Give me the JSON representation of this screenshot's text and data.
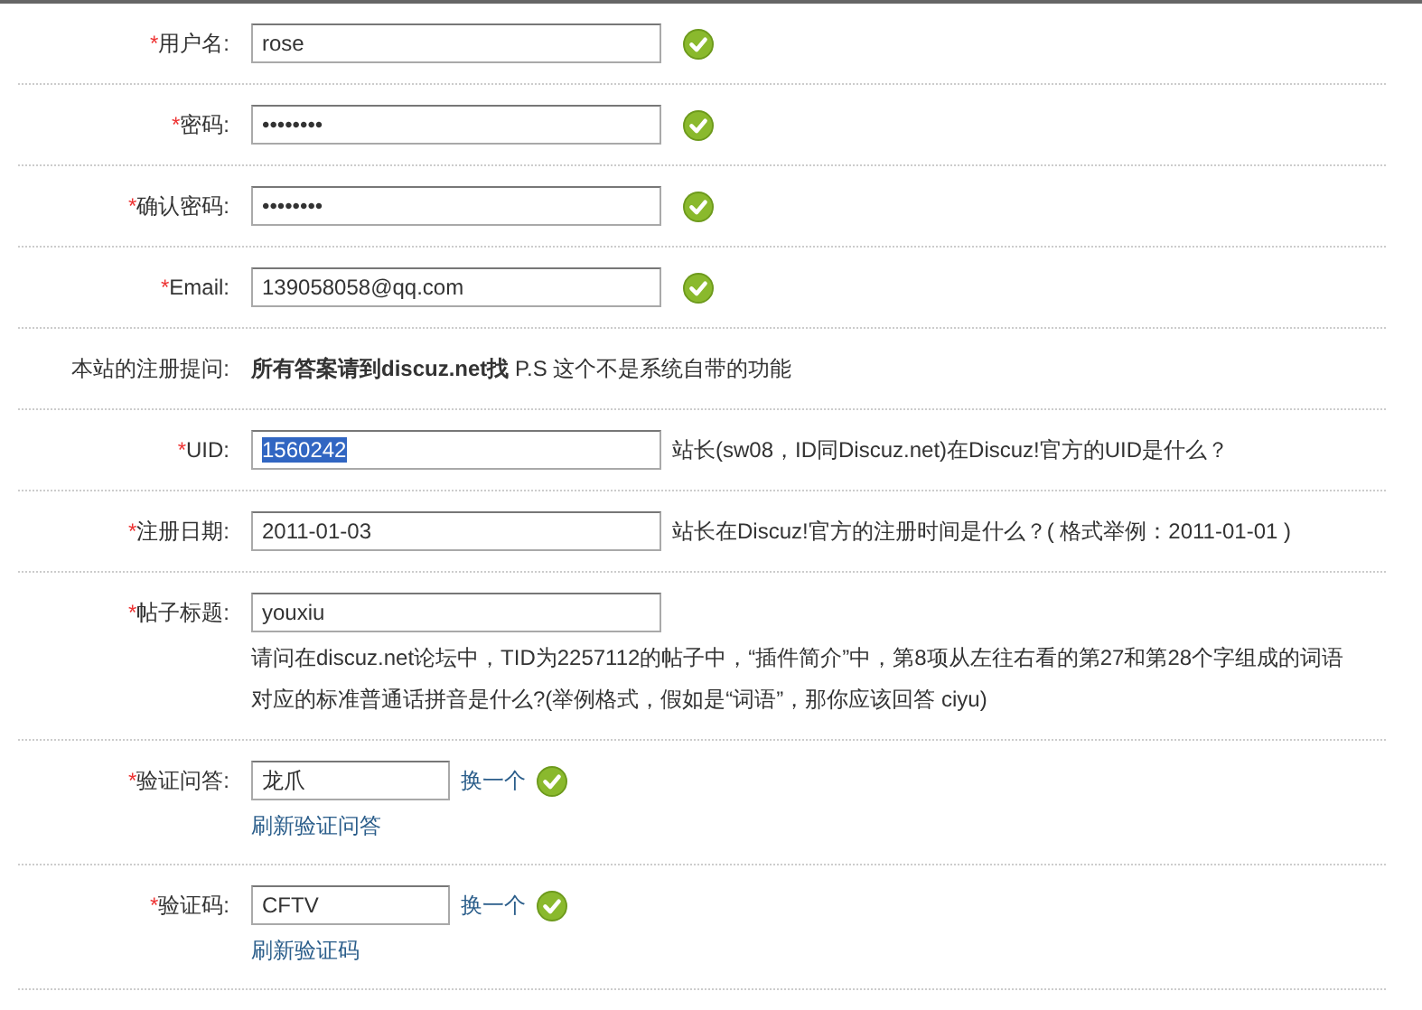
{
  "rows": [
    {
      "kind": "field",
      "mark": "*",
      "label": "用户名:",
      "value": "rose",
      "valid": true
    },
    {
      "kind": "field",
      "mark": "*",
      "label": "密码:",
      "value": "••••••••",
      "valid": true
    },
    {
      "kind": "field",
      "mark": "*",
      "label": "确认密码:",
      "value": "••••••••",
      "valid": true
    },
    {
      "kind": "field",
      "mark": "*",
      "label": "Email:",
      "value": "139058058@qq.com",
      "valid": true
    },
    {
      "kind": "info",
      "label": "本站的注册提问:",
      "text": "**所有答案请到discuz.net找** P.S 这个不是系统自带的功能"
    },
    {
      "kind": "field",
      "mark": "*",
      "label": "UID:",
      "value": "1560242",
      "value_selected": true,
      "valid": false,
      "hint": "站长(sw08，ID同Discuz.net)在Discuz!官方的UID是什么？"
    },
    {
      "kind": "field",
      "mark": "*",
      "label": "注册日期:",
      "value": "2011-01-03",
      "valid": false,
      "hint": "站长在Discuz!官方的注册时间是什么？( 格式举例：2011-01-01 )"
    },
    {
      "kind": "field",
      "mark": "*",
      "label": "帖子标题:",
      "value": "youxiu",
      "valid": false,
      "hint_below": "请问在discuz.net论坛中，TID为2257112的帖子中，“插件简介”中，第8项从左往右看的第27和第28个字组成的词语对应的标准普通话拼音是什么?(举例格式，假如是“词语”，那你应该回答 ciyu)"
    },
    {
      "kind": "captcha",
      "mark": "*",
      "label": "验证问答:",
      "value": "龙爪",
      "change_link": "换一个",
      "valid": true,
      "refresh_link": "刷新验证问答"
    },
    {
      "kind": "captcha",
      "mark": "*",
      "label": "验证码:",
      "value": "CFTV",
      "change_link": "换一个",
      "valid": true,
      "refresh_link": "刷新验证码"
    }
  ]
}
